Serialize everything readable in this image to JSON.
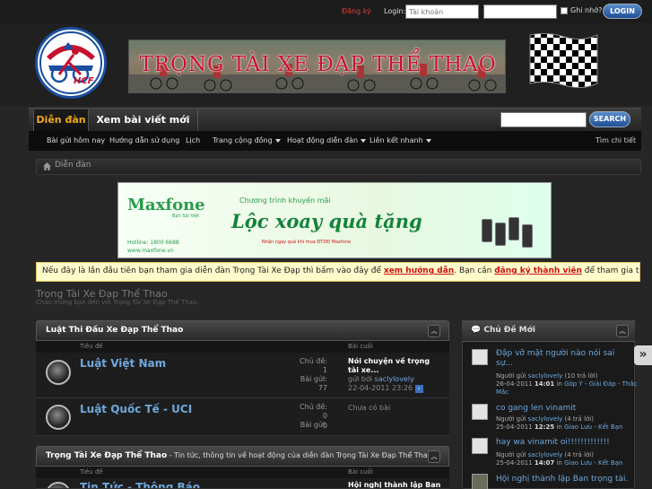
{
  "topbar": {
    "register": "Đăng ký",
    "login_label": "Login:",
    "username_placeholder": "Tài khoản",
    "remember": "Ghi nhớ?",
    "login_button": "LOGIN"
  },
  "header": {
    "logo_text": "HCF",
    "banner_text": "TRỌNG TÀI XE ĐẠP THỂ THAO"
  },
  "nav": {
    "tabs": [
      "Diễn đàn",
      "Xem bài viết mới nhất"
    ],
    "search_button": "SEARCH",
    "sub": [
      "Bài gửi hôm nay",
      "Hướng dẫn sử dụng",
      "Lịch",
      "Trang cộng đồng",
      "Hoạt động diễn đàn",
      "Liên kết nhanh"
    ],
    "sub_right": "Tìm chi tiết"
  },
  "breadcrumb": "Diễn đàn",
  "ad": {
    "brand": "Maxfone",
    "brand_sub": "Bạn Sài Việt",
    "promo_title": "Chương trình khuyến mãi",
    "promo_main": "Lộc xoay quà tặng",
    "promo_note": "Nhận ngay quà khi mua ĐTDĐ Maxfone",
    "hotline": "Hotline: 1800 6688",
    "site": "www.maxfone.vn"
  },
  "notice": {
    "pre": "Nếu đây là lần đầu tiên bạn tham gia diễn đàn Trọng Tài Xe Đạp thì bấm vào đây để ",
    "link1": "xem hướng dẫn",
    "mid": ". Bạn cần ",
    "link2": "đăng ký thành viên",
    "post": " để tham gia thảo luận."
  },
  "forum": {
    "title": "Trọng Tài Xe Đạp Thể Thao",
    "desc": "Chào mừng bạn đến với Trọng Tài Xe Đạp Thể Thao."
  },
  "columns": {
    "title": "Tiêu đề",
    "last": "Bài cuối"
  },
  "categories": [
    {
      "name": "Luật Thi Đấu Xe Đạp Thể Thao",
      "desc": "",
      "forums": [
        {
          "name": "Luật Việt Nam",
          "topics_label": "Chủ đề:",
          "topics": "1",
          "posts_label": "Bài gửi:",
          "posts": "77",
          "last_title": "Nói chuyện về trọng tài xe...",
          "last_by": "gửi bởi",
          "last_user": "saclylovely",
          "last_date": "22-04-2011 23:26"
        },
        {
          "name": "Luật Quốc Tế - UCI",
          "topics_label": "Chủ đề:",
          "topics": "0",
          "posts_label": "Bài gửi:",
          "posts": "0",
          "last_title": "Chưa có bài"
        }
      ]
    },
    {
      "name": "Trọng Tài Xe Đạp Thể Thao",
      "desc": " - Tin tức, thông tin về hoạt động của diễn đàn Trọng Tài Xe Đạp Thể Thao",
      "forums": [
        {
          "name": "Tin Tức - Thông Báo",
          "last_title": "Hội nghị thành lập Ban"
        }
      ]
    }
  ],
  "sidebar": {
    "title": "Chủ Đề Mới",
    "items": [
      {
        "title": "Đập vỡ mặt người nào nói sai sự...",
        "by": "Người gửi",
        "user": "saclylovely",
        "replies": "(10 trả lời)",
        "date": "26-04-2011",
        "time": "14:01",
        "in": "in",
        "forum": "Góp Ý - Giải Đáp - Thắc Mắc"
      },
      {
        "title": "co gang len vinamit",
        "by": "Người gửi",
        "user": "saclylovely",
        "replies": "(4 trả lời)",
        "date": "25-04-2011",
        "time": "12:25",
        "in": "in",
        "forum": "Giao Lưu - Kết Bạn"
      },
      {
        "title": "hay wa vinamit oi!!!!!!!!!!!!!",
        "by": "Người gửi",
        "user": "saclylovely",
        "replies": "(4 trả lời)",
        "date": "25-04-2011",
        "time": "14:07",
        "in": "in",
        "forum": "Giao Lưu - Kết Bạn"
      },
      {
        "title": "Hội nghị thành lập Ban trọng tài..."
      }
    ]
  },
  "colors": {
    "accent": "#f2a81c",
    "link": "#6fa8dc",
    "notice_bg": "#fffbcb"
  }
}
